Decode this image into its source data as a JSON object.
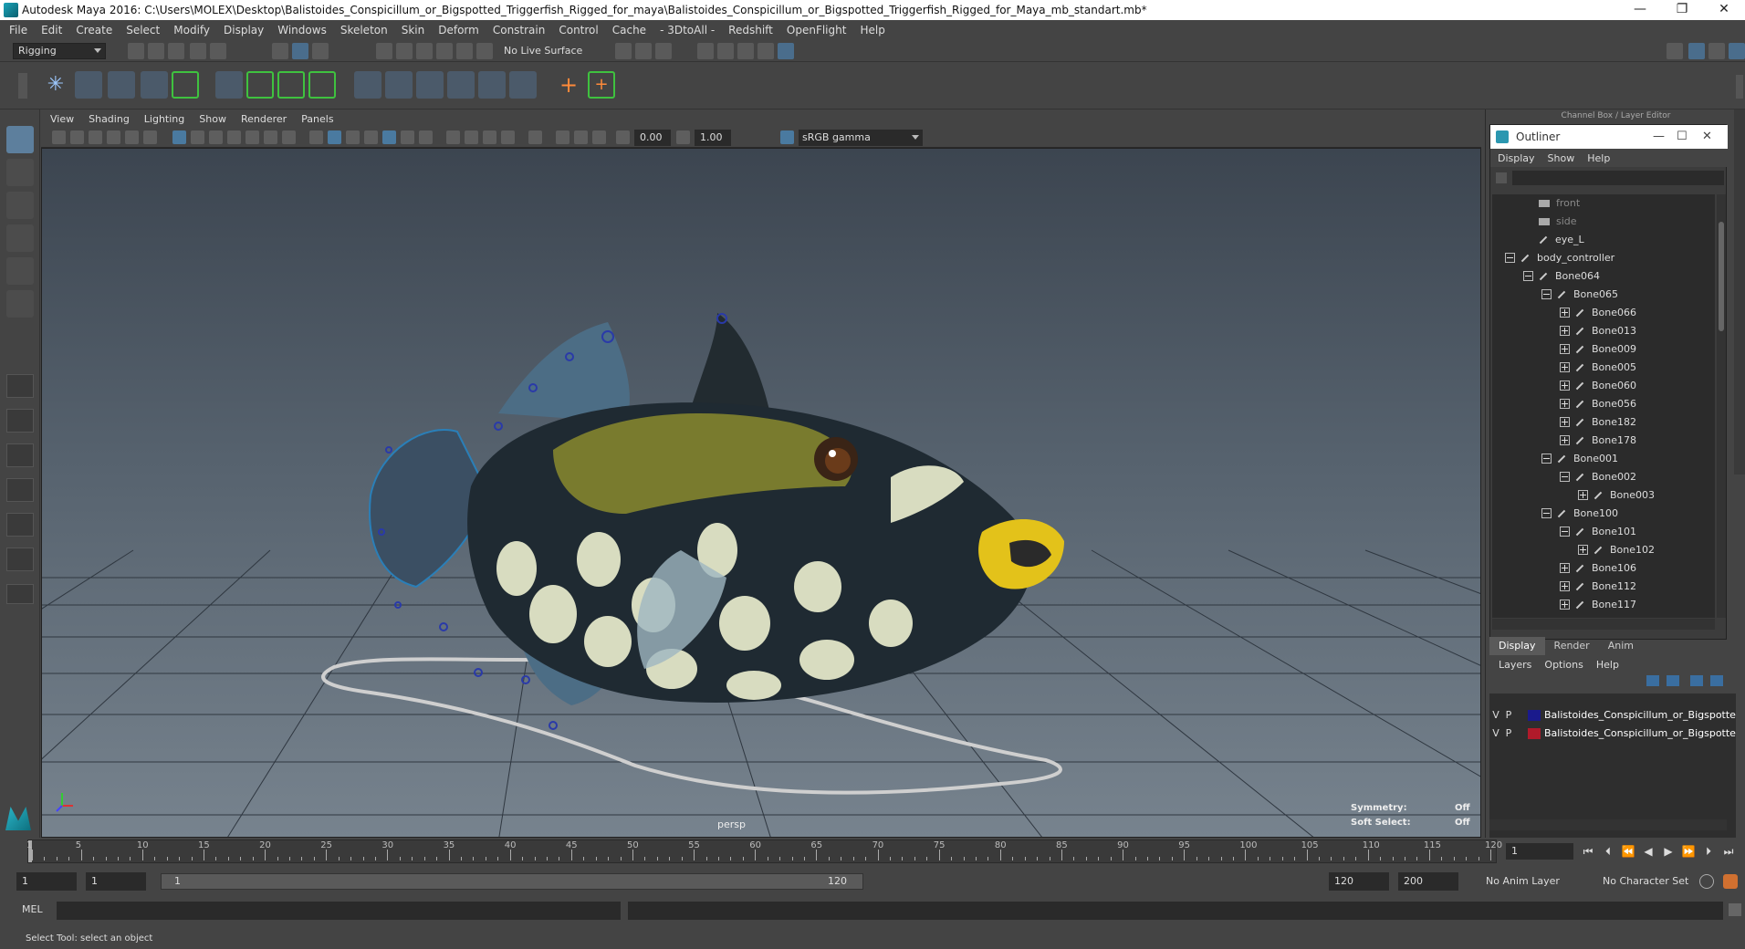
{
  "window": {
    "title": "Autodesk Maya 2016: C:\\Users\\MOLEX\\Desktop\\Balistoides_Conspicillum_or_Bigspotted_Triggerfish_Rigged_for_maya\\Balistoides_Conspicillum_or_Bigspotted_Triggerfish_Rigged_for_Maya_mb_standart.mb*",
    "controls": [
      "—",
      "❐",
      "✕"
    ]
  },
  "menubar": [
    "File",
    "Edit",
    "Create",
    "Select",
    "Modify",
    "Display",
    "Windows",
    "Skeleton",
    "Skin",
    "Deform",
    "Constrain",
    "Control",
    "Cache",
    "- 3DtoAll -",
    "Redshift",
    "OpenFlight",
    "Help"
  ],
  "statusline": {
    "mode": "Rigging",
    "live_surface": "No Live Surface"
  },
  "viewport": {
    "menu": [
      "View",
      "Shading",
      "Lighting",
      "Show",
      "Renderer",
      "Panels"
    ],
    "exposure": "0.00",
    "gamma": "1.00",
    "color_space": "sRGB gamma",
    "camera": "persp",
    "hud": {
      "symmetry_label": "Symmetry:",
      "symmetry_value": "Off",
      "soft_select_label": "Soft Select:",
      "soft_select_value": "Off"
    }
  },
  "channel_box_header": "Channel Box / Layer Editor",
  "outliner": {
    "title": "Outliner",
    "menu": [
      "Display",
      "Show",
      "Help"
    ],
    "items": [
      {
        "label": "front",
        "type": "camera",
        "depth": 1,
        "dim": true,
        "expander": ""
      },
      {
        "label": "side",
        "type": "camera",
        "depth": 1,
        "dim": true,
        "expander": ""
      },
      {
        "label": "eye_L",
        "type": "group",
        "depth": 1,
        "dim": false,
        "expander": ""
      },
      {
        "label": "body_controller",
        "type": "group",
        "depth": 0,
        "dim": false,
        "expander": "minus"
      },
      {
        "label": "Bone064",
        "type": "bone",
        "depth": 1,
        "dim": false,
        "expander": "minus"
      },
      {
        "label": "Bone065",
        "type": "bone",
        "depth": 2,
        "dim": false,
        "expander": "minus"
      },
      {
        "label": "Bone066",
        "type": "bone",
        "depth": 3,
        "dim": false,
        "expander": "plus"
      },
      {
        "label": "Bone013",
        "type": "bone",
        "depth": 3,
        "dim": false,
        "expander": "plus"
      },
      {
        "label": "Bone009",
        "type": "bone",
        "depth": 3,
        "dim": false,
        "expander": "plus"
      },
      {
        "label": "Bone005",
        "type": "bone",
        "depth": 3,
        "dim": false,
        "expander": "plus"
      },
      {
        "label": "Bone060",
        "type": "bone",
        "depth": 3,
        "dim": false,
        "expander": "plus"
      },
      {
        "label": "Bone056",
        "type": "bone",
        "depth": 3,
        "dim": false,
        "expander": "plus"
      },
      {
        "label": "Bone182",
        "type": "bone",
        "depth": 3,
        "dim": false,
        "expander": "plus"
      },
      {
        "label": "Bone178",
        "type": "bone",
        "depth": 3,
        "dim": false,
        "expander": "plus"
      },
      {
        "label": "Bone001",
        "type": "bone",
        "depth": 2,
        "dim": false,
        "expander": "minus"
      },
      {
        "label": "Bone002",
        "type": "bone",
        "depth": 3,
        "dim": false,
        "expander": "minus"
      },
      {
        "label": "Bone003",
        "type": "bone",
        "depth": 4,
        "dim": false,
        "expander": "plus"
      },
      {
        "label": "Bone100",
        "type": "bone",
        "depth": 2,
        "dim": false,
        "expander": "minus"
      },
      {
        "label": "Bone101",
        "type": "bone",
        "depth": 3,
        "dim": false,
        "expander": "minus"
      },
      {
        "label": "Bone102",
        "type": "bone",
        "depth": 4,
        "dim": false,
        "expander": "plus"
      },
      {
        "label": "Bone106",
        "type": "bone",
        "depth": 3,
        "dim": false,
        "expander": "plus"
      },
      {
        "label": "Bone112",
        "type": "bone",
        "depth": 3,
        "dim": false,
        "expander": "plus"
      },
      {
        "label": "Bone117",
        "type": "bone",
        "depth": 3,
        "dim": false,
        "expander": "plus"
      }
    ]
  },
  "layer_editor": {
    "tabs": [
      "Display",
      "Render",
      "Anim"
    ],
    "active_tab": "Display",
    "menu": [
      "Layers",
      "Options",
      "Help"
    ],
    "layers": [
      {
        "v": "V",
        "p": "P",
        "color": "#1a1a8c",
        "name": "Balistoides_Conspicillum_or_Bigspotted_"
      },
      {
        "v": "V",
        "p": "P",
        "color": "#b01a2a",
        "name": "Balistoides_Conspicillum_or_Bigspotted_"
      }
    ]
  },
  "timeline": {
    "ticks": [
      1,
      5,
      10,
      15,
      20,
      25,
      30,
      35,
      40,
      45,
      50,
      55,
      60,
      65,
      70,
      75,
      80,
      85,
      90,
      95,
      100,
      105,
      110,
      115,
      120
    ],
    "current_frame": "1",
    "start": 1,
    "end": 120
  },
  "range": {
    "start_time": "1",
    "playback_start": "1",
    "slider_start": "1",
    "slider_end": "120",
    "playback_end": "120",
    "end_time": "200",
    "anim_layer": "No Anim Layer",
    "character_set": "No Character Set"
  },
  "command": {
    "language": "MEL"
  },
  "help_line": "Select Tool: select an object",
  "colors": {
    "bg": "#444444",
    "panel_dark": "#2b2b2b",
    "selected_tool": "#5d7f9d"
  }
}
